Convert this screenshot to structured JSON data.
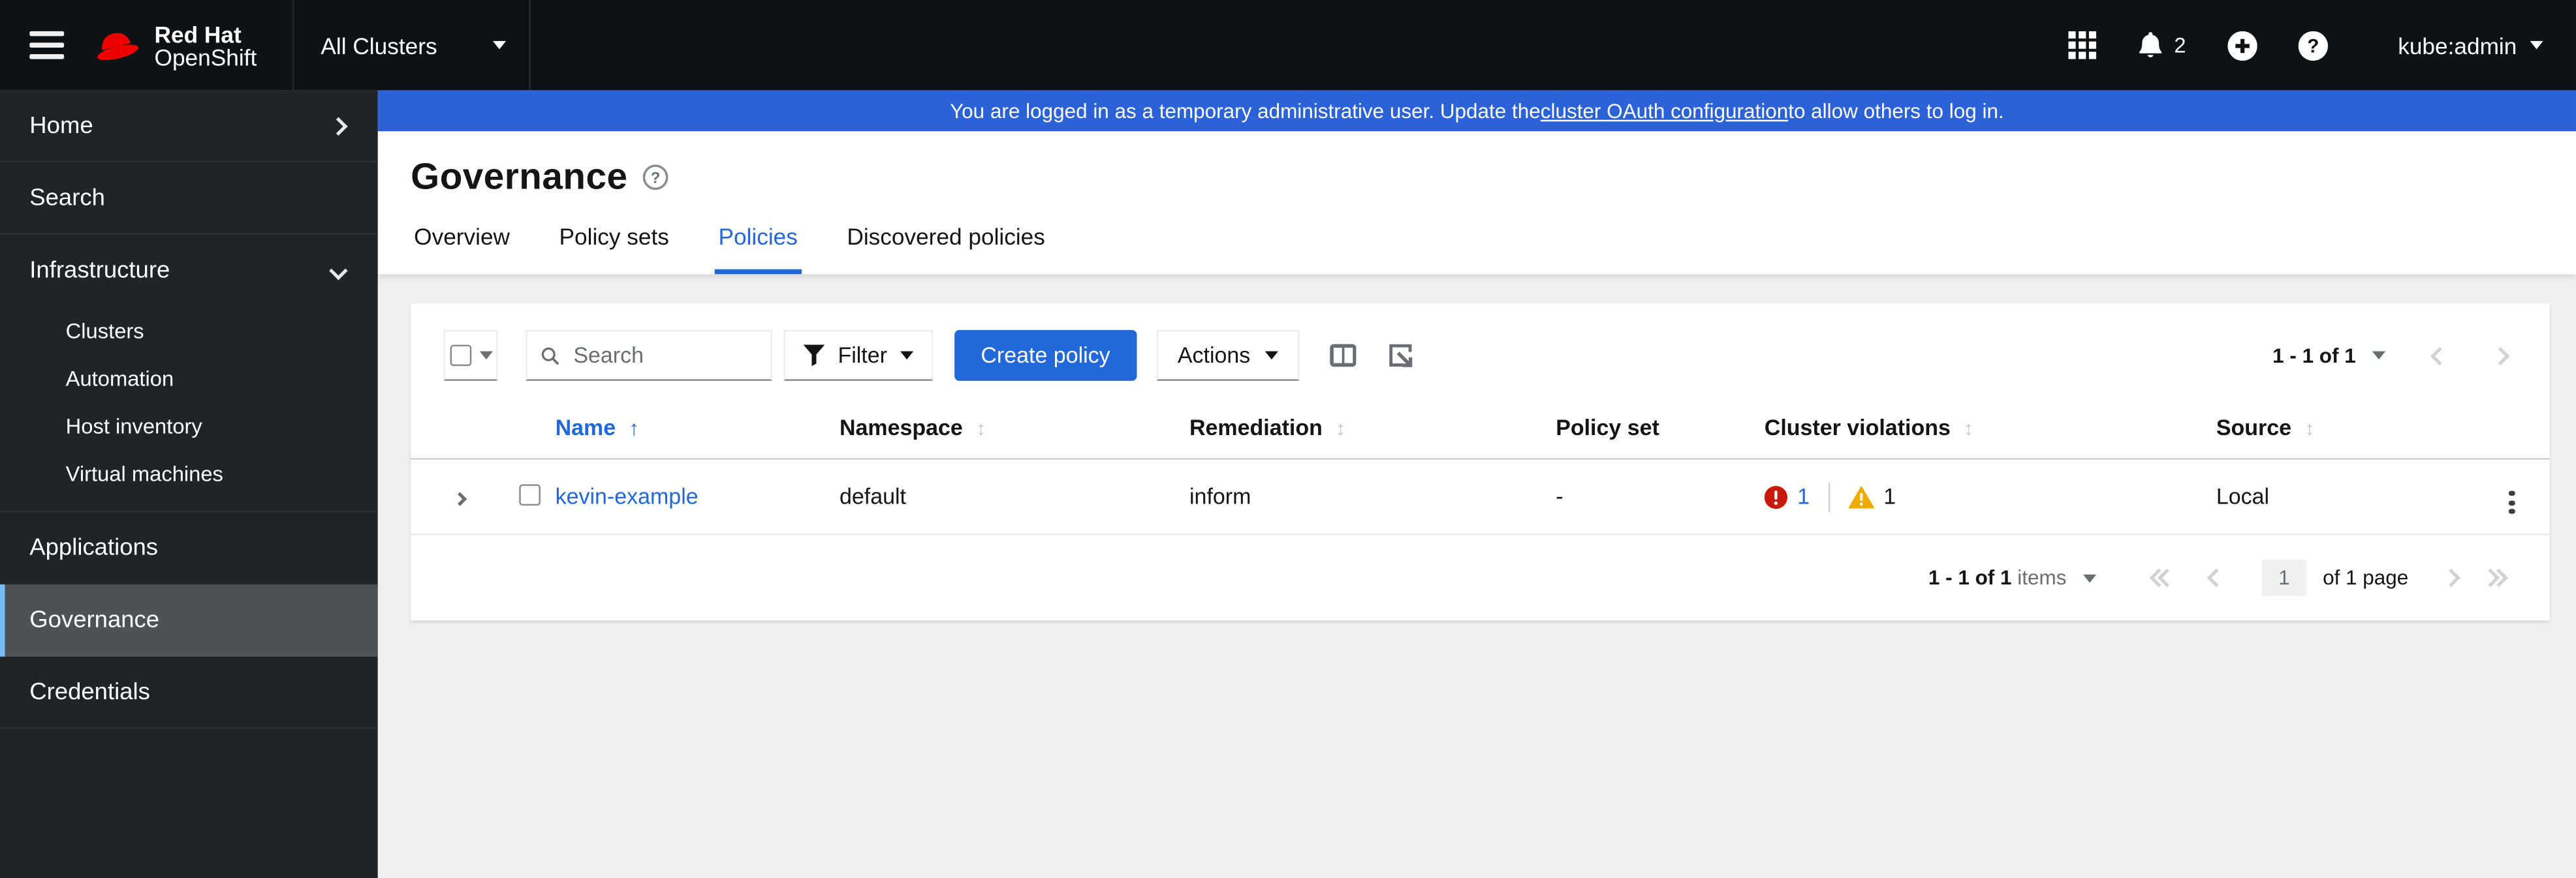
{
  "masthead": {
    "logo_line1": "Red Hat",
    "logo_line2": "OpenShift",
    "cluster_selector": "All Clusters",
    "notifications_count": "2",
    "username": "kube:admin"
  },
  "banner": {
    "text_before": "You are logged in as a temporary administrative user. Update the ",
    "link": "cluster OAuth configuration",
    "text_after": " to allow others to log in."
  },
  "sidebar": {
    "home": "Home",
    "search": "Search",
    "infrastructure": "Infrastructure",
    "infra_children": {
      "clusters": "Clusters",
      "automation": "Automation",
      "host_inventory": "Host inventory",
      "virtual_machines": "Virtual machines"
    },
    "applications": "Applications",
    "governance": "Governance",
    "credentials": "Credentials"
  },
  "page": {
    "title": "Governance",
    "tabs": [
      {
        "label": "Overview"
      },
      {
        "label": "Policy sets"
      },
      {
        "label": "Policies",
        "active": true
      },
      {
        "label": "Discovered policies"
      }
    ]
  },
  "toolbar": {
    "search_placeholder": "Search",
    "filter_label": "Filter",
    "create_button": "Create policy",
    "actions_label": "Actions",
    "pagination_summary": "1 - 1 of 1"
  },
  "table": {
    "columns": [
      "Name",
      "Namespace",
      "Remediation",
      "Policy set",
      "Cluster violations",
      "Source"
    ],
    "rows": [
      {
        "name": "kevin-example",
        "namespace": "default",
        "remediation": "inform",
        "policy_set": "-",
        "violations_danger": "1",
        "violations_warning": "1",
        "source": "Local"
      }
    ]
  },
  "pagination": {
    "items_summary_strong": "1 - 1 of 1",
    "items_summary_muted": "items",
    "page_value": "1",
    "page_of": "of 1 page"
  },
  "icons": {
    "masthead": [
      "hamburger",
      "redhat-hat",
      "apps-grid",
      "bell",
      "plus-circle",
      "question-circle",
      "caret-down"
    ],
    "toolbar": [
      "search",
      "filter-funnel",
      "columns",
      "export"
    ],
    "table": [
      "expand-chevron",
      "sort",
      "sort-ascending",
      "exclamation-circle",
      "warning-triangle",
      "kebab"
    ]
  },
  "colors": {
    "accent": "#2268d8",
    "banner": "#2b62d8",
    "danger": "#c9190b",
    "warning": "#f0ab00",
    "nav_active_indicator": "#73bcf7",
    "masthead_bg": "#0f1214",
    "sidebar_bg": "#212427",
    "content_bg": "#f0f0f0"
  }
}
